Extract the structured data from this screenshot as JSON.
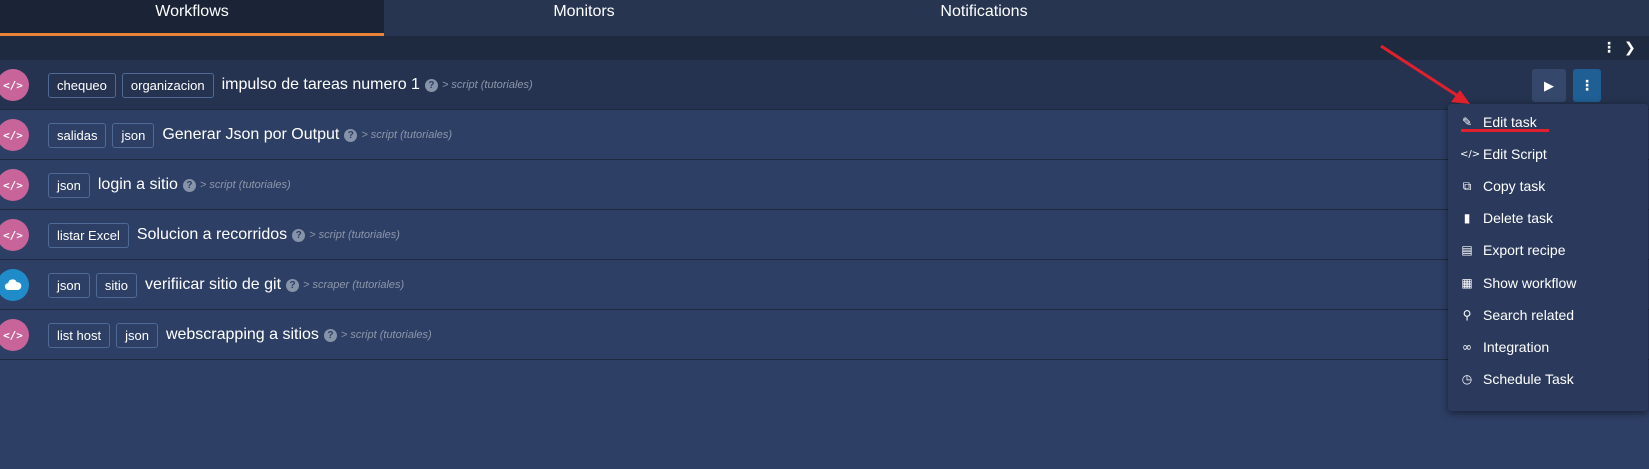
{
  "tabs": [
    {
      "label": "Workflows",
      "active": true
    },
    {
      "label": "Monitors",
      "active": false
    },
    {
      "label": "Notifications",
      "active": false
    }
  ],
  "toolbar": {
    "kebab_icon": "vertical-ellipsis-icon",
    "next_icon": "chevron-right-icon"
  },
  "tasks": [
    {
      "tags": [
        "chequeo",
        "organizacion"
      ],
      "name": "impulso de tareas numero 1",
      "type": "> script (tutoriales)",
      "icon": "code-icon"
    },
    {
      "tags": [
        "salidas",
        "json"
      ],
      "name": "Generar Json por Output",
      "type": "> script (tutoriales)",
      "icon": "code-icon"
    },
    {
      "tags": [
        "json"
      ],
      "name": "login a sitio",
      "type": "> script (tutoriales)",
      "icon": "code-icon"
    },
    {
      "tags": [
        "listar Excel"
      ],
      "name": "Solucion a recorridos",
      "type": "> script (tutoriales)",
      "icon": "code-icon"
    },
    {
      "tags": [
        "json",
        "sitio"
      ],
      "name": "verifiicar sitio de git",
      "type": "> scraper (tutoriales)",
      "icon": "cloud-icon"
    },
    {
      "tags": [
        "list host",
        "json"
      ],
      "name": "webscrapping a sitios",
      "type": "> script (tutoriales)",
      "icon": "code-icon"
    }
  ],
  "row_actions": {
    "play_icon": "play-icon",
    "more_icon": "vertical-ellipsis-icon"
  },
  "context_menu": {
    "items": [
      {
        "label": "Edit task",
        "icon": "edit-icon"
      },
      {
        "label": "Edit Script",
        "icon": "code-icon"
      },
      {
        "label": "Copy task",
        "icon": "copy-icon"
      },
      {
        "label": "Delete task",
        "icon": "trash-icon"
      },
      {
        "label": "Export recipe",
        "icon": "file-code-icon"
      },
      {
        "label": "Show workflow",
        "icon": "sitemap-icon"
      },
      {
        "label": "Search related",
        "icon": "search-icon"
      },
      {
        "label": "Integration",
        "icon": "link-icon"
      },
      {
        "label": "Schedule Task",
        "icon": "clock-icon"
      }
    ]
  },
  "colors": {
    "background": "#2e3f65",
    "active_tab_underline": "#e8833a",
    "annotation_red": "#e0202c",
    "script_avatar": "#c8649a",
    "scraper_avatar": "#1f8bc8"
  }
}
